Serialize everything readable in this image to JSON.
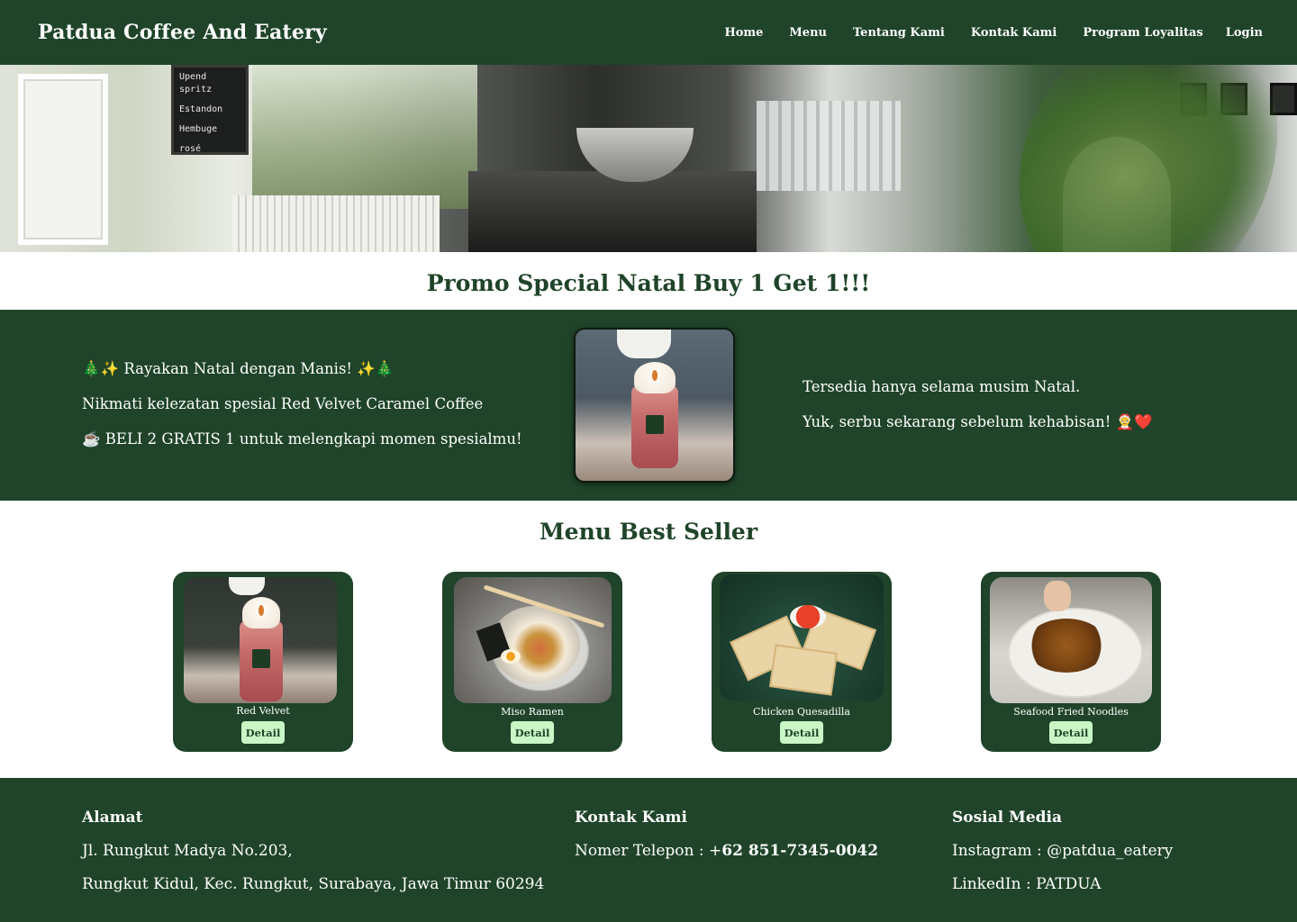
{
  "nav": {
    "brand": "Patdua Coffee And Eatery",
    "links": [
      "Home",
      "Menu",
      "Tentang Kami",
      "Kontak Kami",
      "Program Loyalitas",
      "Login"
    ]
  },
  "hero": {
    "chalkboard_lines": [
      "Upend spritz",
      "Estandon",
      "Hembuge",
      "rosé"
    ]
  },
  "promo": {
    "title": "Promo Special Natal Buy 1 Get 1!!!",
    "left_lines": [
      "🎄✨ Rayakan Natal dengan Manis! ✨🎄",
      "Nikmati kelezatan spesial Red Velvet Caramel Coffee",
      "☕ BELI 2 GRATIS 1 untuk melengkapi momen spesialmu!"
    ],
    "right_lines": [
      "Tersedia hanya selama musim Natal.",
      "Yuk, serbu sekarang sebelum kehabisan! 🤶❤️"
    ]
  },
  "best_seller": {
    "title": "Menu Best Seller",
    "items": [
      {
        "name": "Red Velvet",
        "button": "Detail"
      },
      {
        "name": "Miso Ramen",
        "button": "Detail"
      },
      {
        "name": "Chicken Quesadilla",
        "button": "Detail"
      },
      {
        "name": "Seafood Fried Noodles",
        "button": "Detail"
      }
    ]
  },
  "footer": {
    "address": {
      "heading": "Alamat",
      "line1": "Jl. Rungkut Madya No.203,",
      "line2": "Rungkut Kidul, Kec. Rungkut, Surabaya, Jawa Timur 60294"
    },
    "contact": {
      "heading": "Kontak Kami",
      "phone_label": "Nomer Telepon : +",
      "phone_number": "62 851-7345-0042"
    },
    "social": {
      "heading": "Sosial Media",
      "instagram": "Instagram : @patdua_eatery",
      "linkedin": "LinkedIn : PATDUA"
    }
  },
  "colors": {
    "primary_green": "#1f4429",
    "button_mint": "#c8f7c5",
    "white": "#ffffff"
  }
}
